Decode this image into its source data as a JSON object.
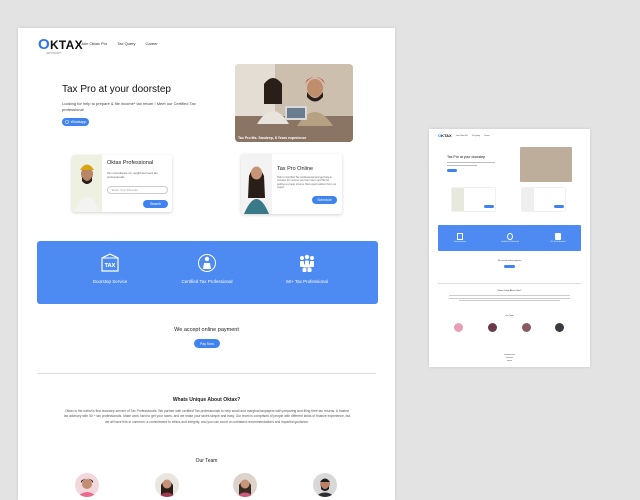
{
  "brand": {
    "logo_o": "O",
    "logo_rest": "KTAX",
    "tagline": "ADVISORY"
  },
  "nav": {
    "items": [
      "Join Oktax Pro",
      "Tax Query",
      "Career"
    ]
  },
  "hero": {
    "title": "Tax Pro at your doorstep",
    "description": "Looking for help to prepare & file income* tax return ! Meet our Certified Tax professional",
    "button_label": "Whatsapp",
    "photo_caption": "Tax Pro Ms. Sandeep, 8 Years experience"
  },
  "cards": {
    "professional": {
      "title": "Oktax Professional",
      "text": "Tax compliance for neighbourhood tax professionals",
      "input_placeholder": "Enter Your Pincode",
      "button_label": "Search"
    },
    "online": {
      "title": "Tax Pro Online",
      "text": "Talk to Certified Tax professional and get help in minutes for income your tax return and file for getting a proper income filed expert advice from our expert",
      "button_label": "Schedule"
    }
  },
  "features": [
    {
      "label": "Doorstep Service",
      "icon": "tax-box-icon"
    },
    {
      "label": "Certified Tax Professional",
      "icon": "certified-pro-icon"
    },
    {
      "label": "50+ Tax Professional",
      "icon": "group-icon"
    }
  ],
  "payment": {
    "title": "We accept online payment",
    "button_label": "Pay Now"
  },
  "unique": {
    "title": "Whats Unique About Oktax?",
    "text": "Oktax is the nation's first doorstep service of Tax Professionals. We partner with certified Tax professionals to help small and marginal taxpayers with preparing and filing their tax returns. A trusted tax advisory with 50 + tax professionals. Make work hard to get your taxes, and we make your taxes simple and easy. Our team is comprised of people with different kinds of finance experience, but we all have this in common: a commitment to ethics and integrity, and you can count on unbiased recommendations and impartial guidance."
  },
  "team": {
    "title": "Our Team"
  },
  "mini": {
    "logo_o": "O",
    "logo_rest": "KTAX",
    "nav": [
      "Join Oktax Pro",
      "Tax Query",
      "Career"
    ],
    "hero_title": "Tax Pro at your doorstep",
    "features": [
      "Doorstep Service",
      "Certified Tax Professional",
      "50+ Tax Professional"
    ],
    "payment_title": "We accept online payment",
    "unique_title": "Whats Unique About Oktax?",
    "team_title": "Our Team"
  },
  "colors": {
    "accent": "#3f83f1",
    "band": "#4d8af2",
    "background": "#e3e3e3"
  }
}
